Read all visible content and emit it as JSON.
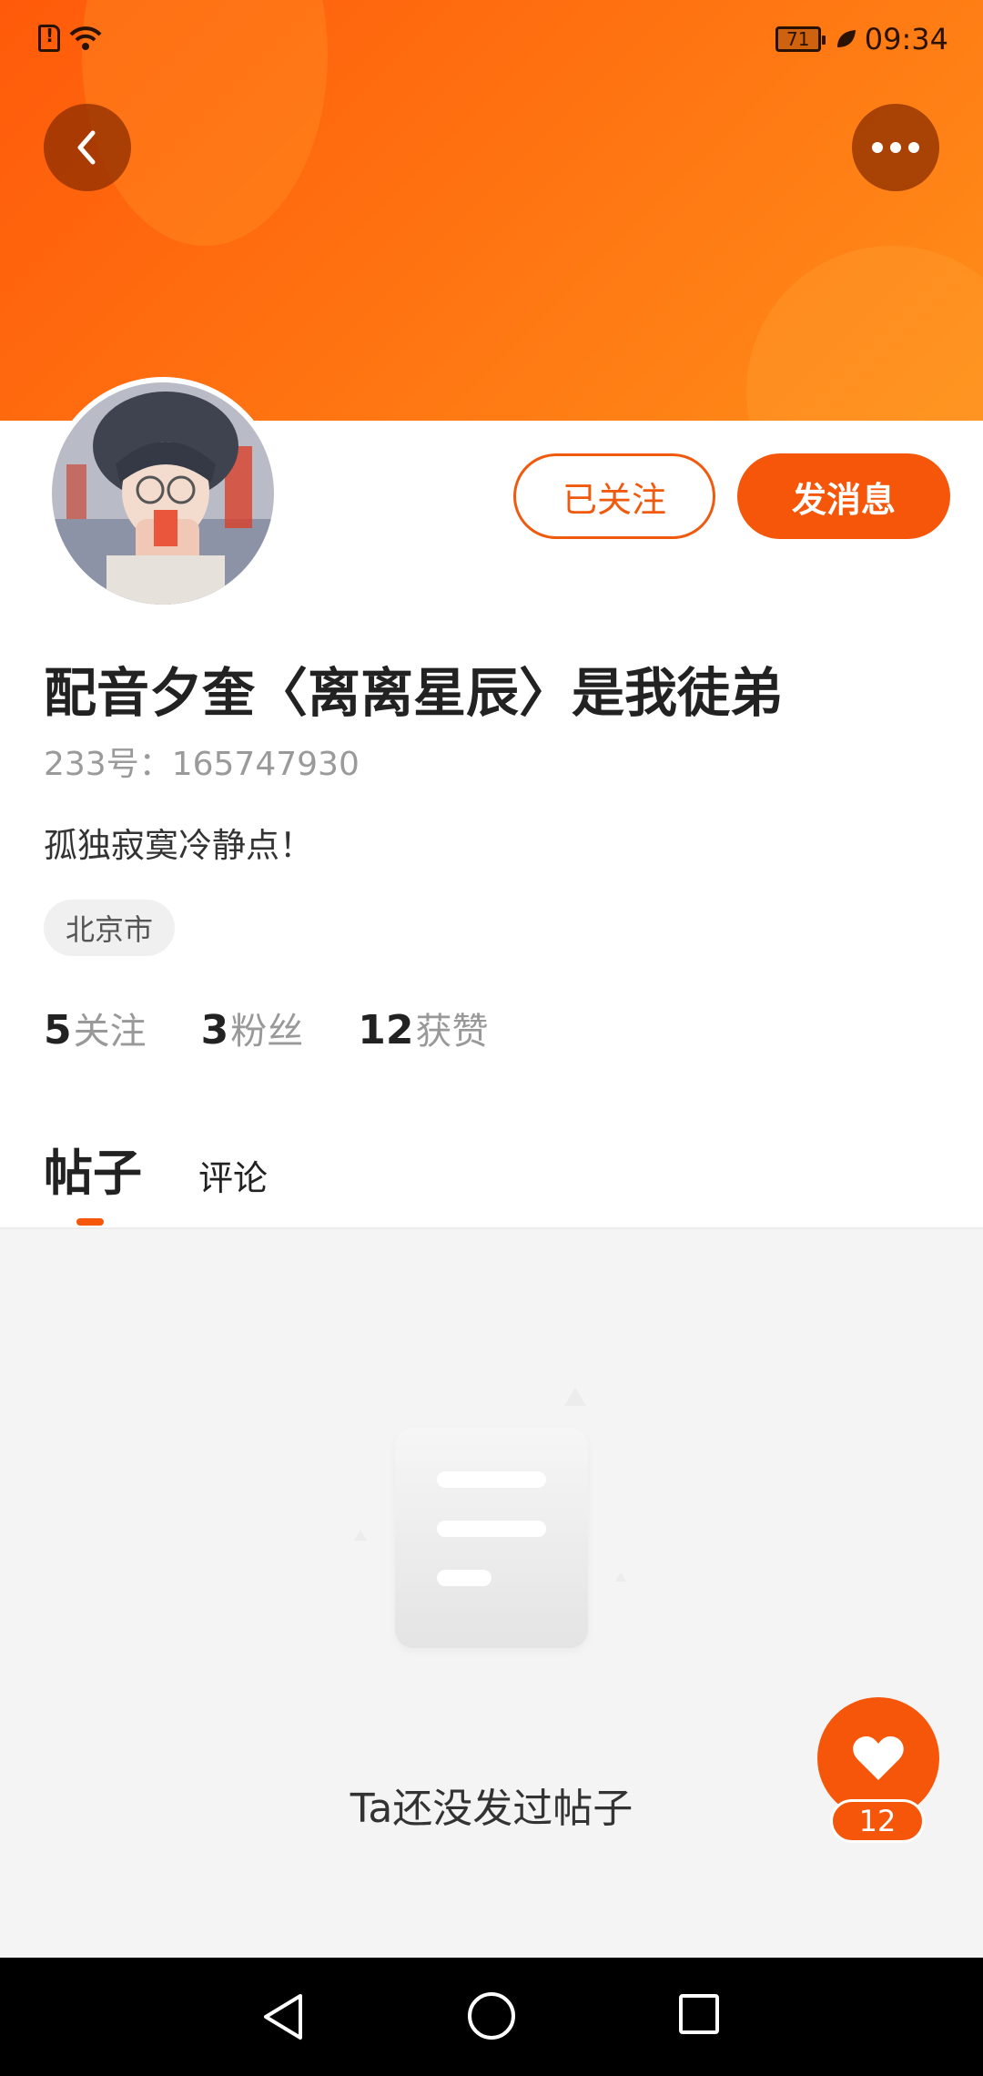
{
  "status_bar": {
    "battery": "71",
    "time": "09:34"
  },
  "profile": {
    "nickname": "配音夕奎〈离离星辰〉是我徒弟",
    "user_id": "233号：165747930",
    "bio": "孤独寂寞冷静点！",
    "location": "北京市",
    "follow_button": "已关注",
    "message_button": "发消息"
  },
  "stats": [
    {
      "count": "5",
      "label": "关注"
    },
    {
      "count": "3",
      "label": "粉丝"
    },
    {
      "count": "12",
      "label": "获赞"
    }
  ],
  "tabs": [
    {
      "label": "帖子",
      "active": true
    },
    {
      "label": "评论",
      "active": false
    }
  ],
  "empty_state": {
    "text": "Ta还没发过帖子"
  },
  "like_fab": {
    "count": "12"
  },
  "colors": {
    "accent": "#f5560a",
    "header": "#ff6a0e"
  },
  "icons": [
    "back-icon",
    "more-icon",
    "heart-icon",
    "nav-back-icon",
    "nav-home-icon",
    "nav-recent-icon"
  ]
}
